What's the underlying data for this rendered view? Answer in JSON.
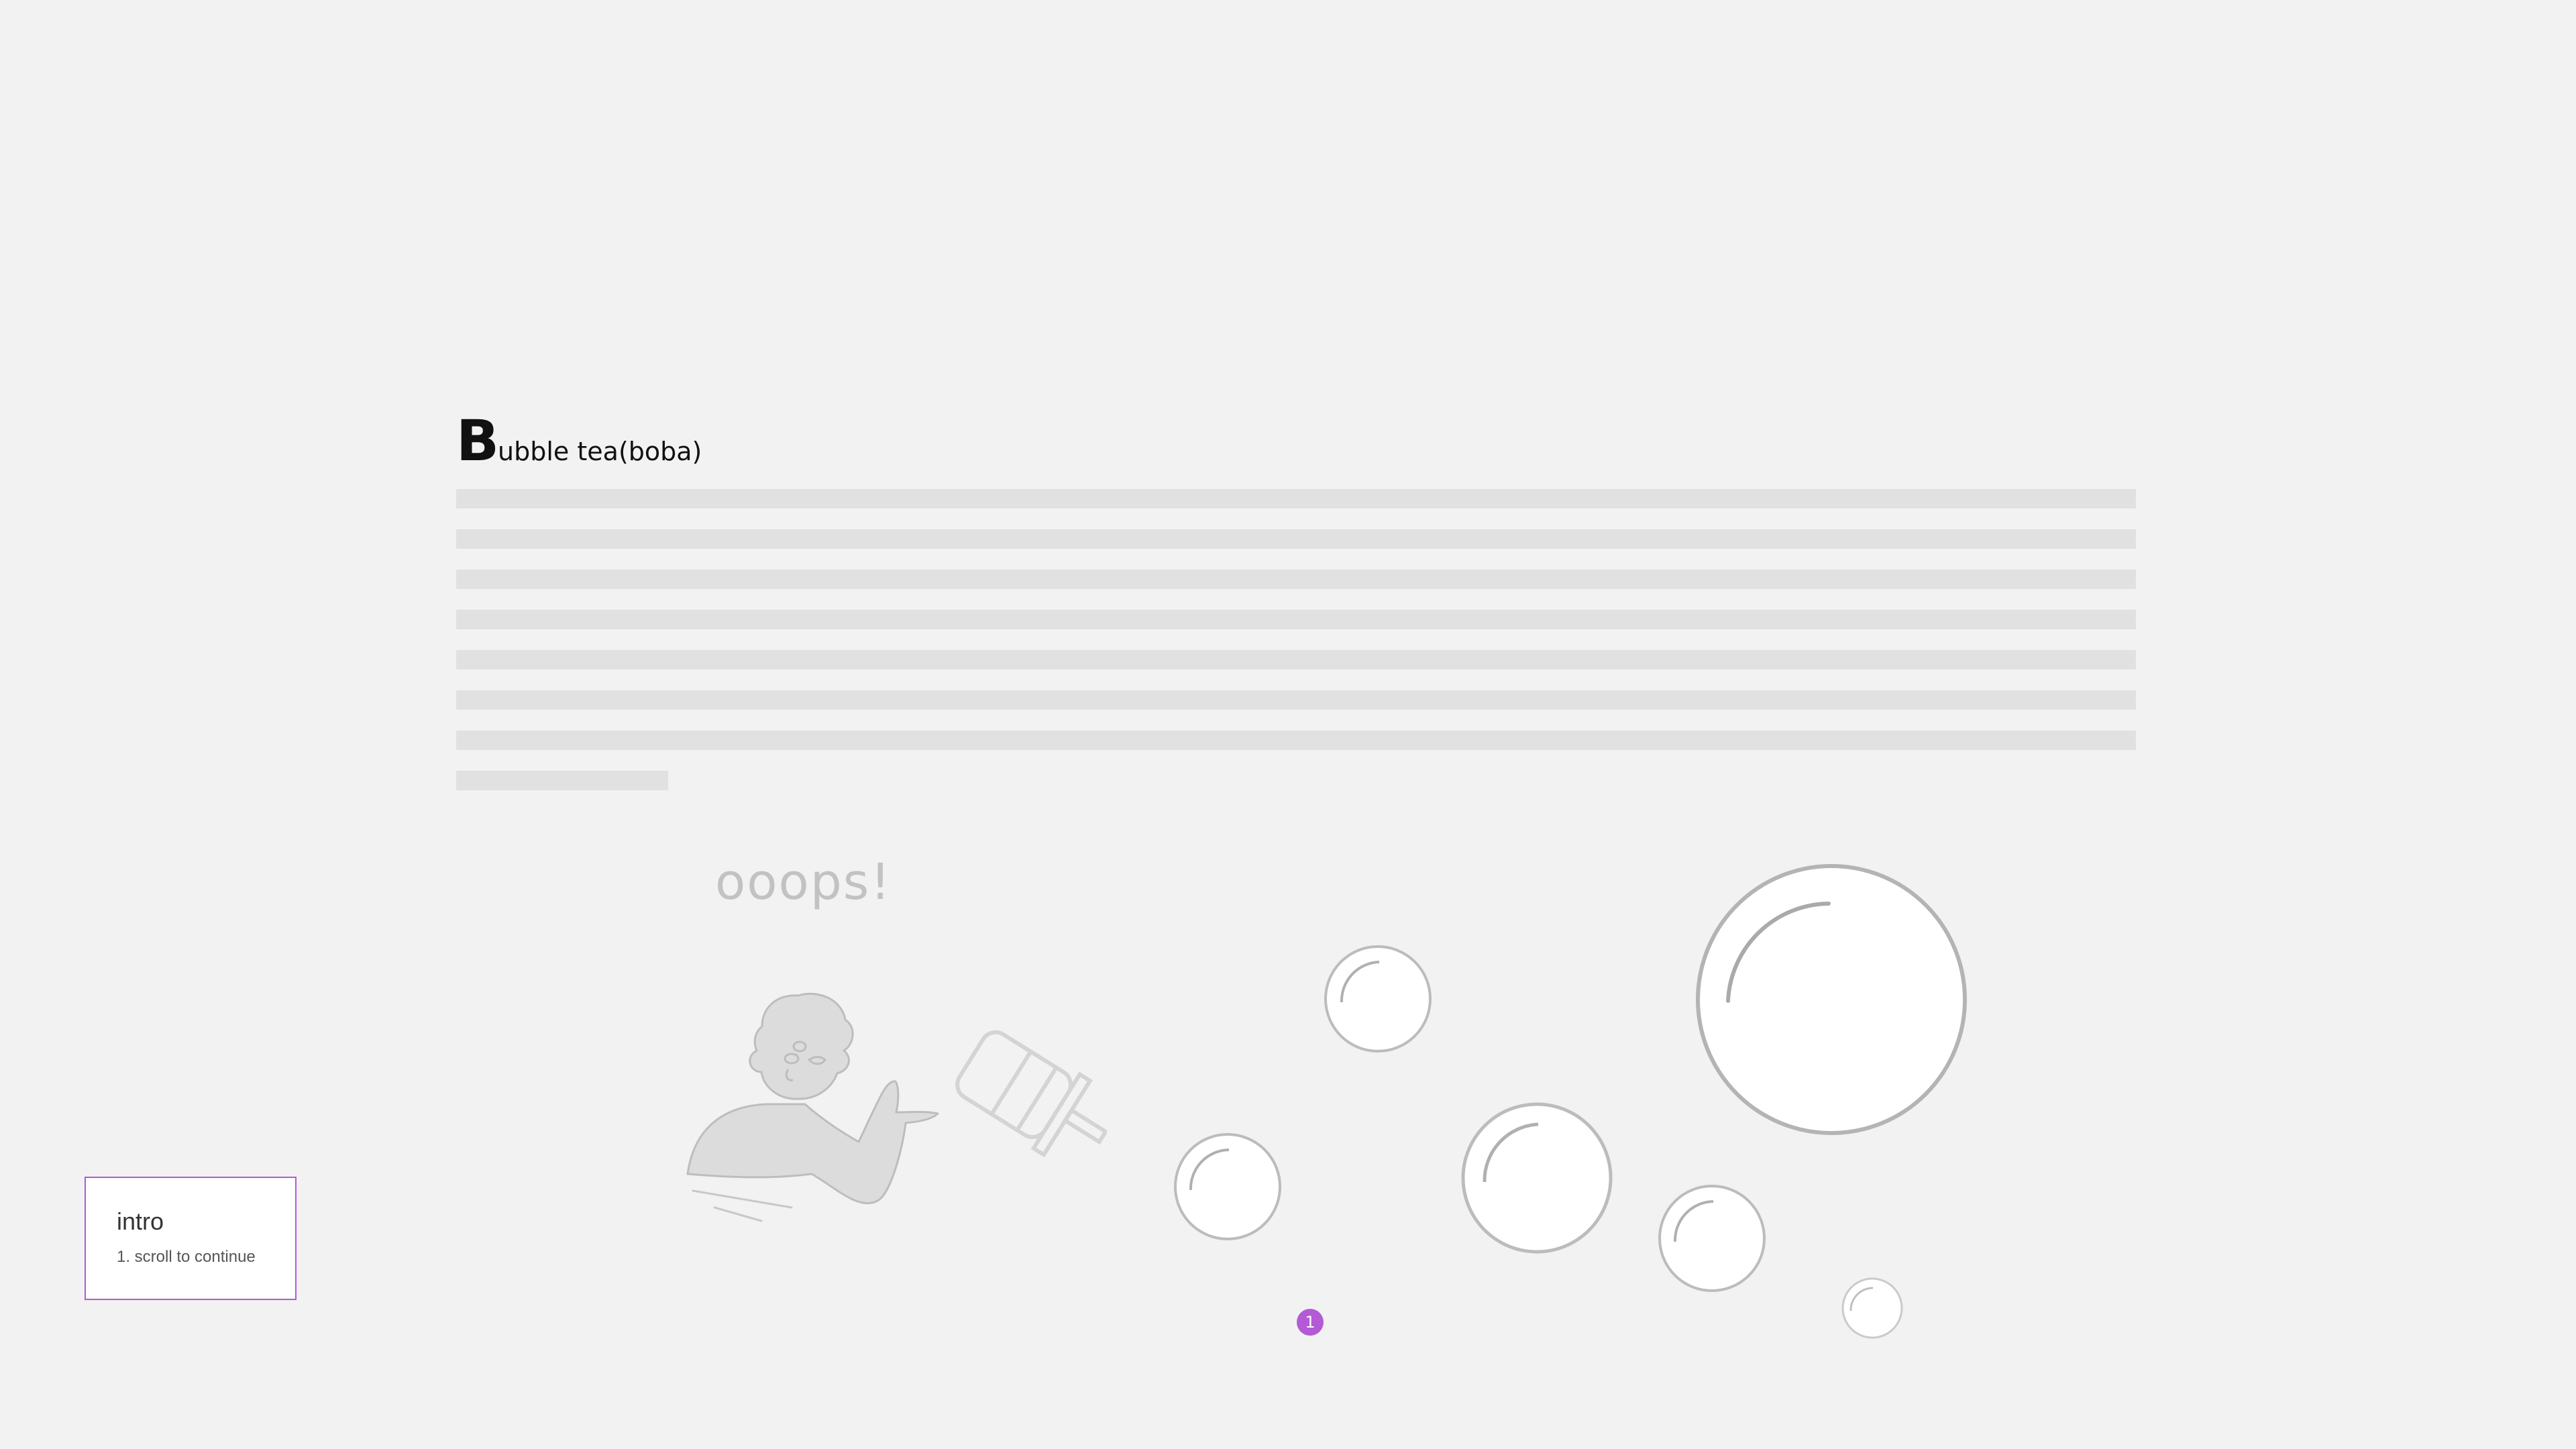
{
  "article": {
    "title_initial": "B",
    "title_rest": "ubble tea(boba)"
  },
  "illustration": {
    "caption": "ooops!",
    "character_icon": "person-waving-icon",
    "cup_icon": "tipped-bubble-tea-cup-icon",
    "bubble_icon": "bubble-icon"
  },
  "pager": {
    "current_step": "1",
    "accent_color": "#b35ad6"
  },
  "intro_card": {
    "title": "intro",
    "subtitle": "1. scroll to continue"
  }
}
